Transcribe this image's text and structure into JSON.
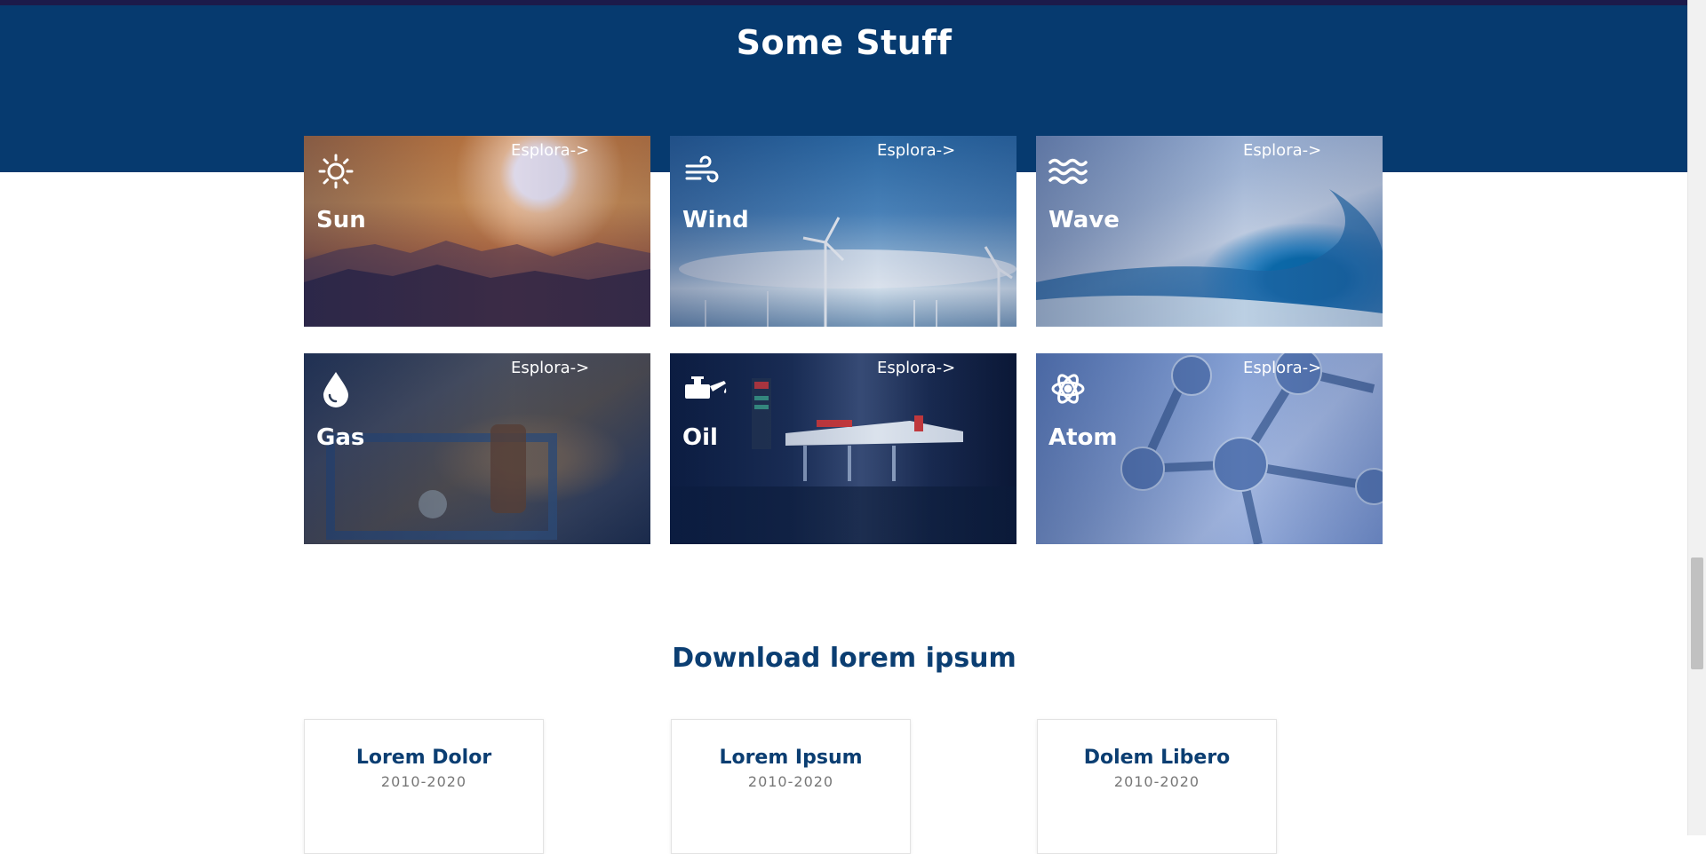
{
  "hero": {
    "title": "Some Stuff"
  },
  "tiles": [
    {
      "label": "Sun",
      "explore": "Esplora->",
      "icon": "sun-icon"
    },
    {
      "label": "Wind",
      "explore": "Esplora->",
      "icon": "wind-icon"
    },
    {
      "label": "Wave",
      "explore": "Esplora->",
      "icon": "wave-icon"
    },
    {
      "label": "Gas",
      "explore": "Esplora->",
      "icon": "drop-icon"
    },
    {
      "label": "Oil",
      "explore": "Esplora->",
      "icon": "oil-can-icon"
    },
    {
      "label": "Atom",
      "explore": "Esplora->",
      "icon": "atom-icon"
    }
  ],
  "downloads": {
    "title": "Download lorem ipsum",
    "cards": [
      {
        "name": "Lorem Dolor",
        "years": "2010-2020"
      },
      {
        "name": "Lorem Ipsum",
        "years": "2010-2020"
      },
      {
        "name": "Dolem Libero",
        "years": "2010-2020"
      }
    ]
  },
  "colors": {
    "hero_bg": "#063a6f",
    "heading": "#0b3e72"
  }
}
